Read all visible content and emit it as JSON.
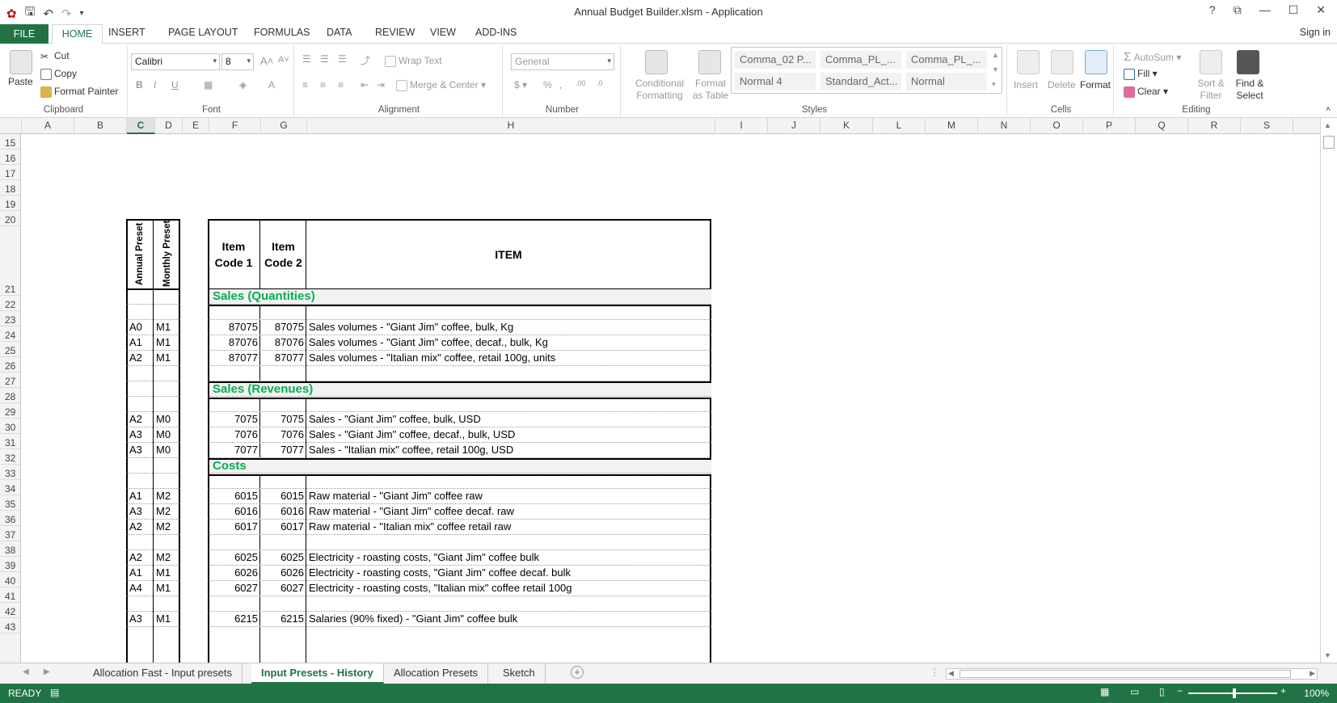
{
  "window": {
    "title": "Annual Budget Builder.xlsm - Application",
    "help": "?",
    "signin": "Sign in"
  },
  "tabs": {
    "file": "FILE",
    "home": "HOME",
    "insert": "INSERT",
    "page_layout": "PAGE LAYOUT",
    "formulas": "FORMULAS",
    "data": "DATA",
    "review": "REVIEW",
    "view": "VIEW",
    "addins": "ADD-INS"
  },
  "ribbon": {
    "clipboard": {
      "label": "Clipboard",
      "paste": "Paste",
      "cut": "Cut",
      "copy": "Copy",
      "format_painter": "Format Painter"
    },
    "font": {
      "label": "Font",
      "name": "Calibri",
      "size": "8"
    },
    "alignment": {
      "label": "Alignment",
      "wrap": "Wrap Text",
      "merge": "Merge & Center"
    },
    "number": {
      "label": "Number",
      "format": "General"
    },
    "styles": {
      "label": "Styles",
      "conditional": "Conditional Formatting",
      "format_table": "Format as Table",
      "gallery": [
        "Comma_02 P...",
        "Comma_PL_...",
        "Comma_PL_...",
        "Normal 4",
        "Standard_Act...",
        "Normal"
      ]
    },
    "cells": {
      "label": "Cells",
      "insert": "Insert",
      "delete": "Delete",
      "format": "Format"
    },
    "editing": {
      "label": "Editing",
      "autosum": "AutoSum",
      "fill": "Fill",
      "clear": "Clear",
      "sort": "Sort & Filter",
      "find": "Find & Select"
    }
  },
  "columns": [
    "A",
    "B",
    "C",
    "D",
    "E",
    "F",
    "G",
    "H",
    "I",
    "J",
    "K",
    "L",
    "M",
    "N",
    "O",
    "P",
    "Q",
    "R",
    "S"
  ],
  "selected_column": "C",
  "rows": [
    "15",
    "16",
    "17",
    "18",
    "19",
    "20",
    "21",
    "22",
    "23",
    "24",
    "25",
    "26",
    "27",
    "28",
    "29",
    "30",
    "31",
    "32",
    "33",
    "34",
    "35",
    "36",
    "37",
    "38",
    "39",
    "40",
    "41",
    "42",
    "43"
  ],
  "table": {
    "header": {
      "annual": "Annual Preset",
      "monthly": "Monthly Preset",
      "code1": "Item Code 1",
      "code2": "Item Code 2",
      "item": "ITEM"
    },
    "sections": {
      "qty": "Sales (Quantities)",
      "rev": "Sales (Revenues)",
      "costs": "Costs"
    },
    "data": [
      {
        "a": "A0",
        "m": "M1",
        "c1": "87075",
        "c2": "87075",
        "item": "Sales volumes - \"Giant Jim\" coffee, bulk, Kg"
      },
      {
        "a": "A1",
        "m": "M1",
        "c1": "87076",
        "c2": "87076",
        "item": "Sales volumes - \"Giant Jim\" coffee, decaf., bulk, Kg"
      },
      {
        "a": "A2",
        "m": "M1",
        "c1": "87077",
        "c2": "87077",
        "item": "Sales volumes - \"Italian mix\" coffee, retail 100g, units"
      },
      {
        "a": "A2",
        "m": "M0",
        "c1": "7075",
        "c2": "7075",
        "item": "Sales - \"Giant Jim\" coffee, bulk, USD"
      },
      {
        "a": "A3",
        "m": "M0",
        "c1": "7076",
        "c2": "7076",
        "item": "Sales - \"Giant Jim\" coffee, decaf., bulk, USD"
      },
      {
        "a": "A3",
        "m": "M0",
        "c1": "7077",
        "c2": "7077",
        "item": "Sales - \"Italian mix\" coffee, retail 100g, USD"
      },
      {
        "a": "A1",
        "m": "M2",
        "c1": "6015",
        "c2": "6015",
        "item": "Raw material - \"Giant Jim\" coffee raw"
      },
      {
        "a": "A3",
        "m": "M2",
        "c1": "6016",
        "c2": "6016",
        "item": "Raw material - \"Giant Jim\" coffee decaf. raw"
      },
      {
        "a": "A2",
        "m": "M2",
        "c1": "6017",
        "c2": "6017",
        "item": "Raw material - \"Italian mix\" coffee retail raw"
      },
      {
        "a": "A2",
        "m": "M2",
        "c1": "6025",
        "c2": "6025",
        "item": "Electricity - roasting costs, \"Giant Jim\" coffee bulk"
      },
      {
        "a": "A1",
        "m": "M1",
        "c1": "6026",
        "c2": "6026",
        "item": "Electricity - roasting costs, \"Giant Jim\" coffee decaf. bulk"
      },
      {
        "a": "A4",
        "m": "M1",
        "c1": "6027",
        "c2": "6027",
        "item": "Electricity - roasting costs, \"Italian mix\" coffee retail 100g"
      },
      {
        "a": "A3",
        "m": "M1",
        "c1": "6215",
        "c2": "6215",
        "item": "Salaries (90% fixed) - \"Giant Jim\" coffee bulk"
      }
    ]
  },
  "sheets": [
    "Allocation Fast - Input presets",
    "Input Presets - History",
    "Allocation Presets",
    "Sketch"
  ],
  "active_sheet": "Input Presets - History",
  "status": {
    "ready": "READY",
    "zoom": "100%"
  },
  "colors": {
    "accent": "#217346",
    "section": "#00b050"
  }
}
